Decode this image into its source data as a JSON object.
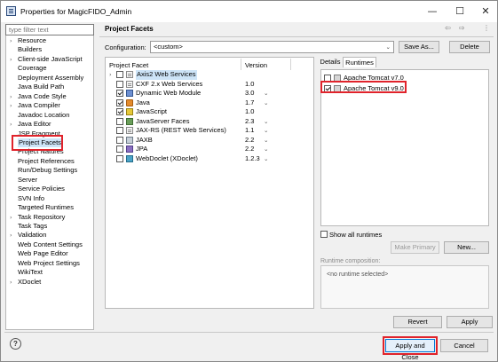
{
  "window": {
    "title": "Properties for MagicFIDO_Admin",
    "minimize_glyph": "—",
    "maximize_glyph": "☐",
    "close_glyph": "✕"
  },
  "filter": {
    "placeholder": "type filter text"
  },
  "tree": {
    "items": [
      {
        "label": "Resource",
        "expandable": true
      },
      {
        "label": "Builders",
        "expandable": false
      },
      {
        "label": "Client-side JavaScript",
        "expandable": true
      },
      {
        "label": "Coverage",
        "expandable": false
      },
      {
        "label": "Deployment Assembly",
        "expandable": false
      },
      {
        "label": "Java Build Path",
        "expandable": false
      },
      {
        "label": "Java Code Style",
        "expandable": true
      },
      {
        "label": "Java Compiler",
        "expandable": true
      },
      {
        "label": "Javadoc Location",
        "expandable": false
      },
      {
        "label": "Java Editor",
        "expandable": true
      },
      {
        "label": "JSP Fragment",
        "expandable": false
      },
      {
        "label": "Project Facets",
        "expandable": false,
        "selected": true
      },
      {
        "label": "Project Natures",
        "expandable": false
      },
      {
        "label": "Project References",
        "expandable": false
      },
      {
        "label": "Run/Debug Settings",
        "expandable": false
      },
      {
        "label": "Server",
        "expandable": false
      },
      {
        "label": "Service Policies",
        "expandable": false
      },
      {
        "label": "SVN Info",
        "expandable": false
      },
      {
        "label": "Targeted Runtimes",
        "expandable": false
      },
      {
        "label": "Task Repository",
        "expandable": true
      },
      {
        "label": "Task Tags",
        "expandable": false
      },
      {
        "label": "Validation",
        "expandable": true
      },
      {
        "label": "Web Content Settings",
        "expandable": false
      },
      {
        "label": "Web Page Editor",
        "expandable": false
      },
      {
        "label": "Web Project Settings",
        "expandable": false
      },
      {
        "label": "WikiText",
        "expandable": false
      },
      {
        "label": "XDoclet",
        "expandable": true
      }
    ]
  },
  "page": {
    "title": "Project Facets",
    "nav_back": "⇦",
    "nav_fwd": "⇨",
    "nav_menu": "⋮"
  },
  "configuration": {
    "label": "Configuration:",
    "value": "<custom>",
    "save_as": "Save As...",
    "delete": "Delete"
  },
  "facets": {
    "col_facet": "Project Facet",
    "col_version": "Version",
    "rows": [
      {
        "name": "Axis2 Web Services",
        "version": "",
        "checked": false,
        "expandable": true,
        "icon": "doc-icon",
        "selected": true
      },
      {
        "name": "CXF 2.x Web Services",
        "version": "1.0",
        "checked": false,
        "expandable": false,
        "icon": "doc-icon"
      },
      {
        "name": "Dynamic Web Module",
        "version": "3.0",
        "checked": true,
        "expandable": false,
        "icon": "web-module-icon",
        "has_menu": true
      },
      {
        "name": "Java",
        "version": "1.7",
        "checked": true,
        "expandable": false,
        "icon": "java-icon",
        "has_menu": true
      },
      {
        "name": "JavaScript",
        "version": "1.0",
        "checked": true,
        "expandable": false,
        "icon": "javascript-icon"
      },
      {
        "name": "JavaServer Faces",
        "version": "2.3",
        "checked": false,
        "expandable": false,
        "icon": "jsf-icon",
        "has_menu": true
      },
      {
        "name": "JAX-RS (REST Web Services)",
        "version": "1.1",
        "checked": false,
        "expandable": false,
        "icon": "jaxrs-icon",
        "has_menu": true
      },
      {
        "name": "JAXB",
        "version": "2.2",
        "checked": false,
        "expandable": false,
        "icon": "jaxb-icon",
        "has_menu": true
      },
      {
        "name": "JPA",
        "version": "2.2",
        "checked": false,
        "expandable": false,
        "icon": "jpa-icon",
        "has_menu": true
      },
      {
        "name": "WebDoclet (XDoclet)",
        "version": "1.2.3",
        "checked": false,
        "expandable": false,
        "icon": "webdoclet-icon",
        "has_menu": true
      }
    ]
  },
  "tabs": {
    "details": "Details",
    "runtimes": "Runtimes"
  },
  "runtimes": {
    "items": [
      {
        "name": "Apache Tomcat v7.0",
        "checked": false
      },
      {
        "name": "Apache Tomcat v9.0",
        "checked": true
      }
    ],
    "show_all": "Show all runtimes",
    "make_primary": "Make Primary",
    "new": "New..."
  },
  "composition": {
    "label": "Runtime composition:",
    "placeholder": "<no runtime selected>"
  },
  "buttons": {
    "revert": "Revert",
    "apply": "Apply",
    "apply_close": "Apply and Close",
    "cancel": "Cancel"
  },
  "help": {
    "glyph": "?"
  },
  "glyphs": {
    "expand": "›",
    "dropdown": "⌄"
  },
  "colors": {
    "highlight": "#e0232b",
    "selection": "#cde4f7"
  }
}
